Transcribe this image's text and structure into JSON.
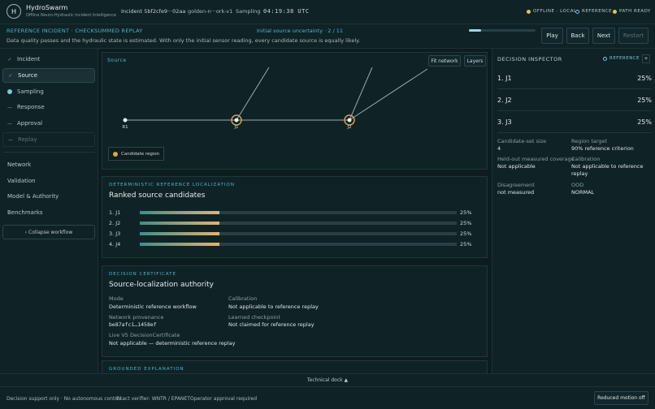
{
  "app": {
    "logo_letter": "H",
    "name": "HydroSwarm",
    "subtitle": "Offline Neuro-Hydraulic Incident Intelligence"
  },
  "header": {
    "incident": "Incident 5bf2cfe9···02aa",
    "branch": "golden-n···ork-v1",
    "mode": "Sampling",
    "clock": "04:19:38 UTC",
    "status": [
      {
        "label": "OFFLINE · LOCAL",
        "color": "#d6c85a"
      },
      {
        "label": "REFERENCE",
        "color": "#7ec6d3"
      },
      {
        "label": "PATH READY",
        "color": "#d6c85a"
      }
    ]
  },
  "subbar": {
    "tag": "REFERENCE INCIDENT · CHECKSUMMED REPLAY",
    "description": "Data quality passes and the hydraulic state is estimated. With only the initial sensor reading, every candidate source is equally likely.",
    "uncertainty": "Initial source uncertainty · 2 / 11",
    "progress_fraction": 0.18,
    "buttons": {
      "play": "Play",
      "back": "Back",
      "next": "Next",
      "restart": "Restart"
    }
  },
  "sidebar": {
    "steps": [
      {
        "mark": "✓",
        "label": "Incident"
      },
      {
        "mark": "✓",
        "label": "Source"
      },
      {
        "mark": "●",
        "label": "Sampling"
      },
      {
        "mark": "—",
        "label": "Response"
      },
      {
        "mark": "—",
        "label": "Approval"
      },
      {
        "mark": "—",
        "label": "Replay"
      }
    ],
    "links": [
      "Network",
      "Validation",
      "Model & Authority",
      "Benchmarks"
    ],
    "collapse": "‹ Collapse workflow"
  },
  "source": {
    "label": "Source",
    "fit_network": "Fit network",
    "layers": "Layers",
    "nodes": [
      "R1",
      "J1",
      "J2"
    ],
    "legend": "Candidate region"
  },
  "ranking": {
    "tag": "DETERMINISTIC REFERENCE LOCALIZATION",
    "title": "Ranked source candidates",
    "rows": [
      {
        "label": "1. J1",
        "value": 0.25,
        "pct": "25%"
      },
      {
        "label": "2. J2",
        "value": 0.25,
        "pct": "25%"
      },
      {
        "label": "3. J3",
        "value": 0.25,
        "pct": "25%"
      },
      {
        "label": "4. J4",
        "value": 0.25,
        "pct": "25%"
      }
    ]
  },
  "certificate": {
    "tag": "DECISION CERTIFICATE",
    "title": "Source-localization authority",
    "mode_k": "Mode",
    "mode_v": "Deterministic reference workflow",
    "calibration_k": "Calibration",
    "calibration_v": "Not applicable to reference replay",
    "provenance_k": "Network provenance",
    "provenance_v": "be87afc1…1458ef",
    "checkpoint_k": "Learned checkpoint",
    "checkpoint_v": "Not claimed for reference replay",
    "live_k": "Live V5 DecisionCertificate",
    "live_v": "Not applicable — deterministic reference replay"
  },
  "explanation": {
    "tag": "GROUNDED EXPLANATION"
  },
  "inspector": {
    "title": "DECISION INSPECTOR",
    "reference": "REFERENCE",
    "plus": "+",
    "candidates": [
      {
        "name": "1. J1",
        "pct": "25%"
      },
      {
        "name": "2. J2",
        "pct": "25%"
      },
      {
        "name": "3. J3",
        "pct": "25%"
      }
    ],
    "set_size_k": "Candidate-set size",
    "set_size_v": "4",
    "region_k": "Region target",
    "region_v": "90% reference criterion",
    "heldout_k": "Held-out measured coverage",
    "heldout_v": "Not applicable",
    "calib_k": "Calibration",
    "calib_v": "Not applicable to reference replay",
    "disagree_k": "Disagreement",
    "disagree_v": "not measured",
    "ood_k": "OOD",
    "ood_v": "NORMAL"
  },
  "footer": {
    "techdock": "Technical dock ▲",
    "support": "Decision support only · No autonomous control",
    "verifier": "Exact verifier: WNTR / EPANET",
    "approval": "Operator approval required",
    "motion": "Reduced motion off"
  }
}
